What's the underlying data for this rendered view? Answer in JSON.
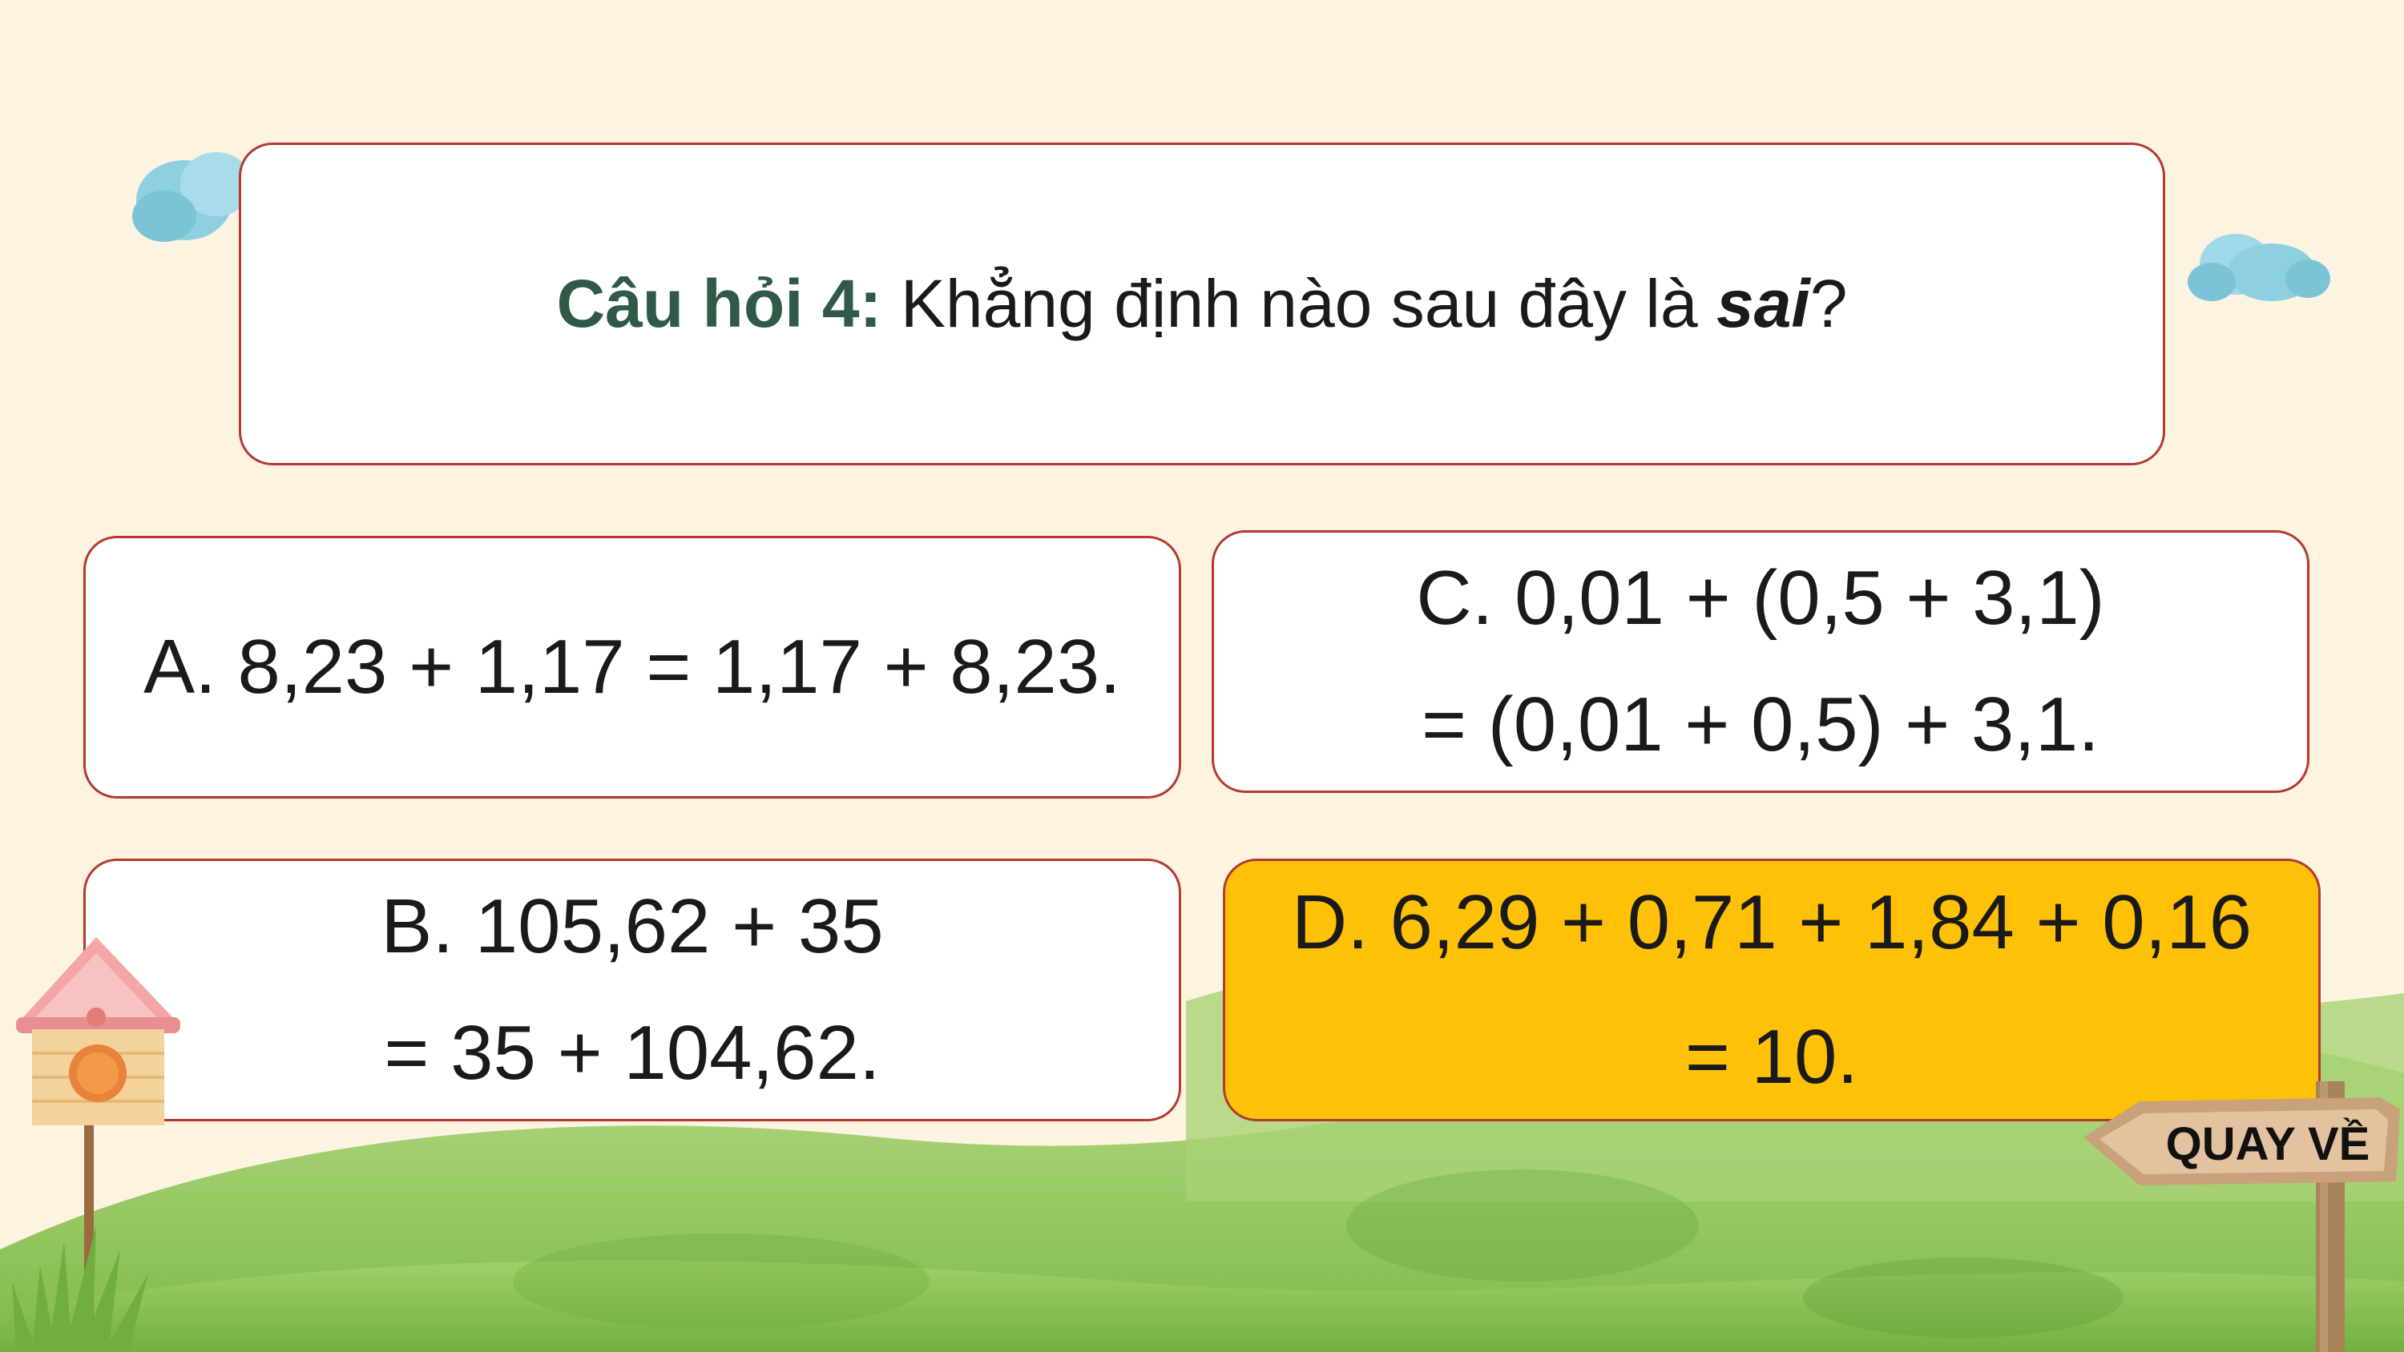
{
  "question": {
    "label": "Câu hỏi 4:",
    "text_before": " Khẳng định nào sau đây là ",
    "emphasis": "sai",
    "text_after": "?"
  },
  "answers": {
    "a": {
      "line1": "A. 8,23 + 1,17 = 1,17 + 8,23."
    },
    "c": {
      "line1": "C. 0,01 + (0,5 + 3,1)",
      "line2": "= (0,01 + 0,5) + 3,1."
    },
    "b": {
      "line1": "B. 105,62 + 35",
      "line2": "= 35 + 104,62."
    },
    "d": {
      "line1": "D. 6,29 + 0,71 + 1,84 + 0,16",
      "line2": "= 10.",
      "highlighted": true
    }
  },
  "nav": {
    "back_label": "QUAY VỀ"
  },
  "colors": {
    "background": "#fcf3e0",
    "card_border": "#b43a2f",
    "question_label": "#2f5a47",
    "highlight": "#ffc107",
    "grass": "#8cc45a"
  },
  "icons": [
    "cloud-icon",
    "birdhouse-icon",
    "signpost-icon",
    "grass-tuft-icon"
  ]
}
